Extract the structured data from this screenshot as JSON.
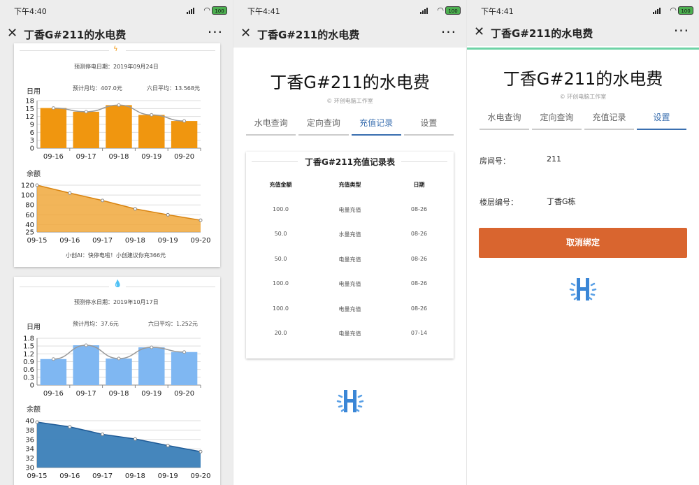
{
  "status": [
    {
      "time": "下午4:40",
      "battery": "100"
    },
    {
      "time": "下午4:41",
      "battery": "100"
    },
    {
      "time": "下午4:41",
      "battery": "100"
    }
  ],
  "nav": {
    "title": "丁香G#211的水电费",
    "close": "✕",
    "more": "···"
  },
  "colors": {
    "electric": "#f0960f",
    "water": "#7fb7f2",
    "water_area": "#3b7fb8",
    "tab_active": "#3a6fb0",
    "unbind_button": "#d9652f",
    "green_accent": "#6ed3a6"
  },
  "electric_card": {
    "icon": "lightning-icon",
    "predict": "预测停电日期：2019年09月24日",
    "usage_label": "日用",
    "monthly": "预计月均：407.0元",
    "avg": "六日平均：13.568元",
    "balance_label": "余额",
    "ai_tip": "小创AI：快停电啦！小创建议你充366元"
  },
  "water_card": {
    "icon": "water-drop-icon",
    "predict": "预测停水日期：2019年10月17日",
    "usage_label": "日用",
    "monthly": "预计月均：37.6元",
    "avg": "六日平均：1.252元",
    "balance_label": "余额"
  },
  "chart_data": [
    {
      "type": "bar",
      "title": "日用",
      "categories": [
        "09-16",
        "09-17",
        "09-18",
        "09-19",
        "09-20"
      ],
      "values": [
        15.2,
        13.8,
        16.3,
        12.6,
        10.3
      ],
      "line_overlay": true,
      "ylim": [
        0,
        18
      ],
      "yticks": [
        0,
        3,
        6,
        9,
        12,
        15,
        18
      ],
      "color": "#f0960f"
    },
    {
      "type": "area",
      "title": "余额",
      "categories": [
        "09-15",
        "09-16",
        "09-17",
        "09-18",
        "09-19",
        "09-20"
      ],
      "values": [
        120,
        104,
        89,
        72,
        60,
        49
      ],
      "ylim": [
        25,
        120
      ],
      "yticks": [
        25,
        40,
        60,
        80,
        100,
        120
      ],
      "color": "#f0a83c"
    },
    {
      "type": "bar",
      "title": "日用",
      "categories": [
        "09-16",
        "09-17",
        "09-18",
        "09-19",
        "09-20"
      ],
      "values": [
        1.0,
        1.53,
        1.02,
        1.45,
        1.27
      ],
      "line_overlay": true,
      "ylim": [
        0,
        1.8
      ],
      "yticks": [
        0,
        0.3,
        0.6,
        0.9,
        1.2,
        1.5,
        1.8
      ],
      "color": "#7fb7f2"
    },
    {
      "type": "area",
      "title": "余额",
      "categories": [
        "09-15",
        "09-16",
        "09-17",
        "09-18",
        "09-19",
        "09-20"
      ],
      "values": [
        39.7,
        38.7,
        37.1,
        36.1,
        34.7,
        33.4
      ],
      "ylim": [
        30,
        40
      ],
      "yticks": [
        30,
        32,
        34,
        36,
        38,
        40
      ],
      "color": "#3b7fb8"
    }
  ],
  "main": {
    "big_title": "丁香G#211的水电费",
    "studio": "© 环创电脑工作室",
    "tabs": [
      "水电查询",
      "定向查询",
      "充值记录",
      "设置"
    ]
  },
  "records": {
    "title": "丁香G#211充值记录表",
    "headers": [
      "充值金额",
      "充值类型",
      "日期"
    ],
    "rows": [
      [
        "100.0",
        "电量充值",
        "08-26"
      ],
      [
        "50.0",
        "水量充值",
        "08-26"
      ],
      [
        "50.0",
        "电量充值",
        "08-26"
      ],
      [
        "100.0",
        "电量充值",
        "08-26"
      ],
      [
        "100.0",
        "电量充值",
        "08-26"
      ],
      [
        "20.0",
        "电量充值",
        "07-14"
      ]
    ]
  },
  "settings": {
    "room_label": "房间号：",
    "room_value": "211",
    "floor_label": "楼层编号：",
    "floor_value": "丁香G栋",
    "unbind": "取消绑定"
  }
}
